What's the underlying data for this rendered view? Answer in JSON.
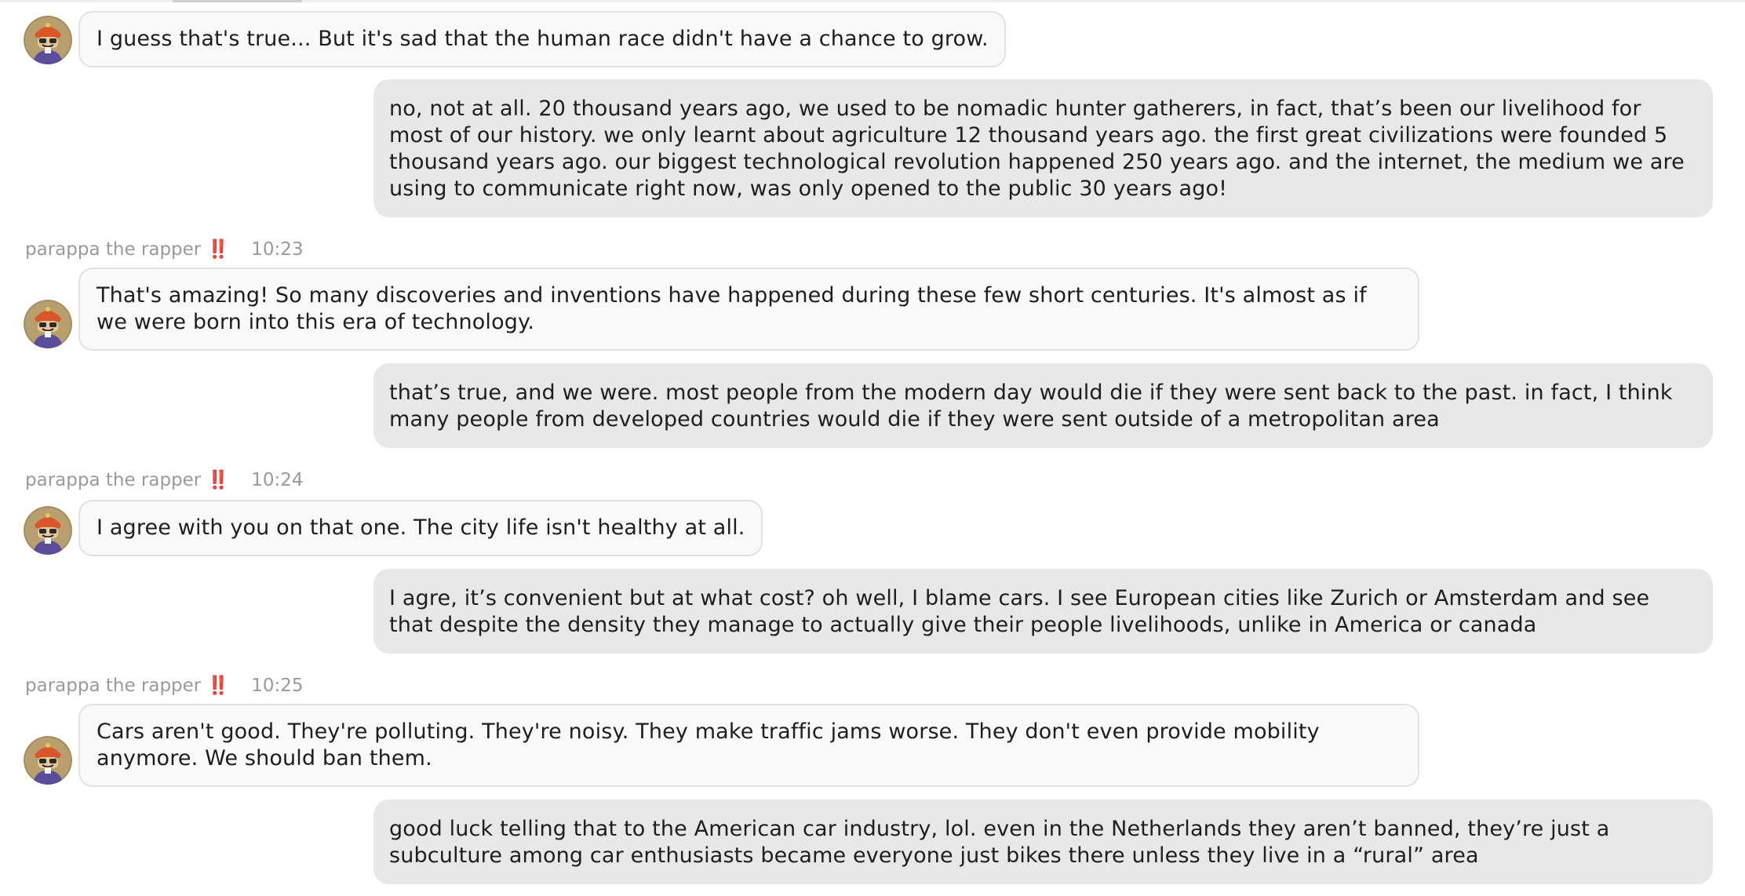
{
  "conversation": {
    "contact_name": "parappa the rapper ‼️",
    "messages": [
      {
        "sender": "them",
        "text": "I guess that's true... But it's sad that the human race didn't have a chance to grow."
      },
      {
        "sender": "me",
        "text": "no, not at all. 20 thousand years ago, we used to be nomadic hunter gatherers, in fact, that’s been our livelihood for most of our history. we only learnt about agriculture 12 thousand years ago. the first great civilizations were founded 5 thousand years ago. our biggest technological revolution happened 250 years ago. and the internet, the medium we are using to communicate right now, was only opened to the public 30 years ago!"
      },
      {
        "sender": "them",
        "name": "parappa the rapper ‼️",
        "time": "10:23",
        "text": "That's amazing! So many discoveries and inventions have happened during these few short centuries. It's almost as if we were born into this era of technology."
      },
      {
        "sender": "me",
        "text": "that’s true, and we were. most people from the modern day would die if they were sent back to the past. in fact, I think many people from developed countries would die if they were sent outside of a metropolitan area"
      },
      {
        "sender": "them",
        "name": "parappa the rapper ‼️",
        "time": "10:24",
        "text": "I agree with you on that one. The city life isn't healthy at all."
      },
      {
        "sender": "me",
        "text": "I agre, it’s convenient but at what cost? oh well, I blame cars. I see European cities like Zurich or Amsterdam and see that despite the density they manage to actually give their people livelihoods, unlike in America or canada"
      },
      {
        "sender": "them",
        "name": "parappa the rapper ‼️",
        "time": "10:25",
        "text": "Cars aren't good. They're polluting. They're noisy. They make traffic jams worse. They don't even provide mobility anymore. We should ban them."
      },
      {
        "sender": "me",
        "text": "good luck telling that to the American car industry, lol. even in the Netherlands they aren’t banned, they’re just a subculture among car enthusiasts became everyone just bikes there unless they live in a “rural” area"
      }
    ]
  },
  "colors": {
    "incoming_bubble": "#f9f9f9",
    "incoming_border": "#e2e2e2",
    "outgoing_bubble": "#e8e8e8",
    "meta_text": "#9a9a9a",
    "message_text": "#1e1e1e"
  },
  "icons": {
    "avatar": "parappa-avatar-icon"
  }
}
